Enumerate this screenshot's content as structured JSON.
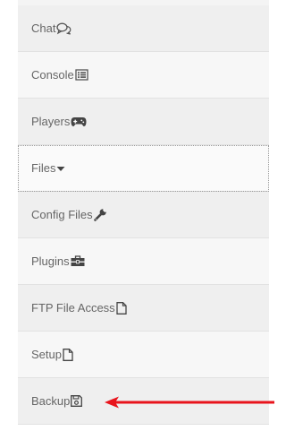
{
  "menu": {
    "items": [
      {
        "label": "Chat",
        "icon": "chat-icon"
      },
      {
        "label": "Console",
        "icon": "console-icon"
      },
      {
        "label": "Players",
        "icon": "gamepad-icon"
      },
      {
        "label": "Files",
        "icon": "caret-down-icon"
      },
      {
        "label": "Config Files",
        "icon": "wrench-icon"
      },
      {
        "label": "Plugins",
        "icon": "toolbox-icon"
      },
      {
        "label": "FTP File Access",
        "icon": "file-icon"
      },
      {
        "label": "Setup",
        "icon": "file-icon"
      },
      {
        "label": "Backup",
        "icon": "save-icon"
      }
    ],
    "active_item": "Files"
  },
  "annotation": {
    "arrow_color": "#e8141c",
    "arrow_target": "Backup"
  }
}
